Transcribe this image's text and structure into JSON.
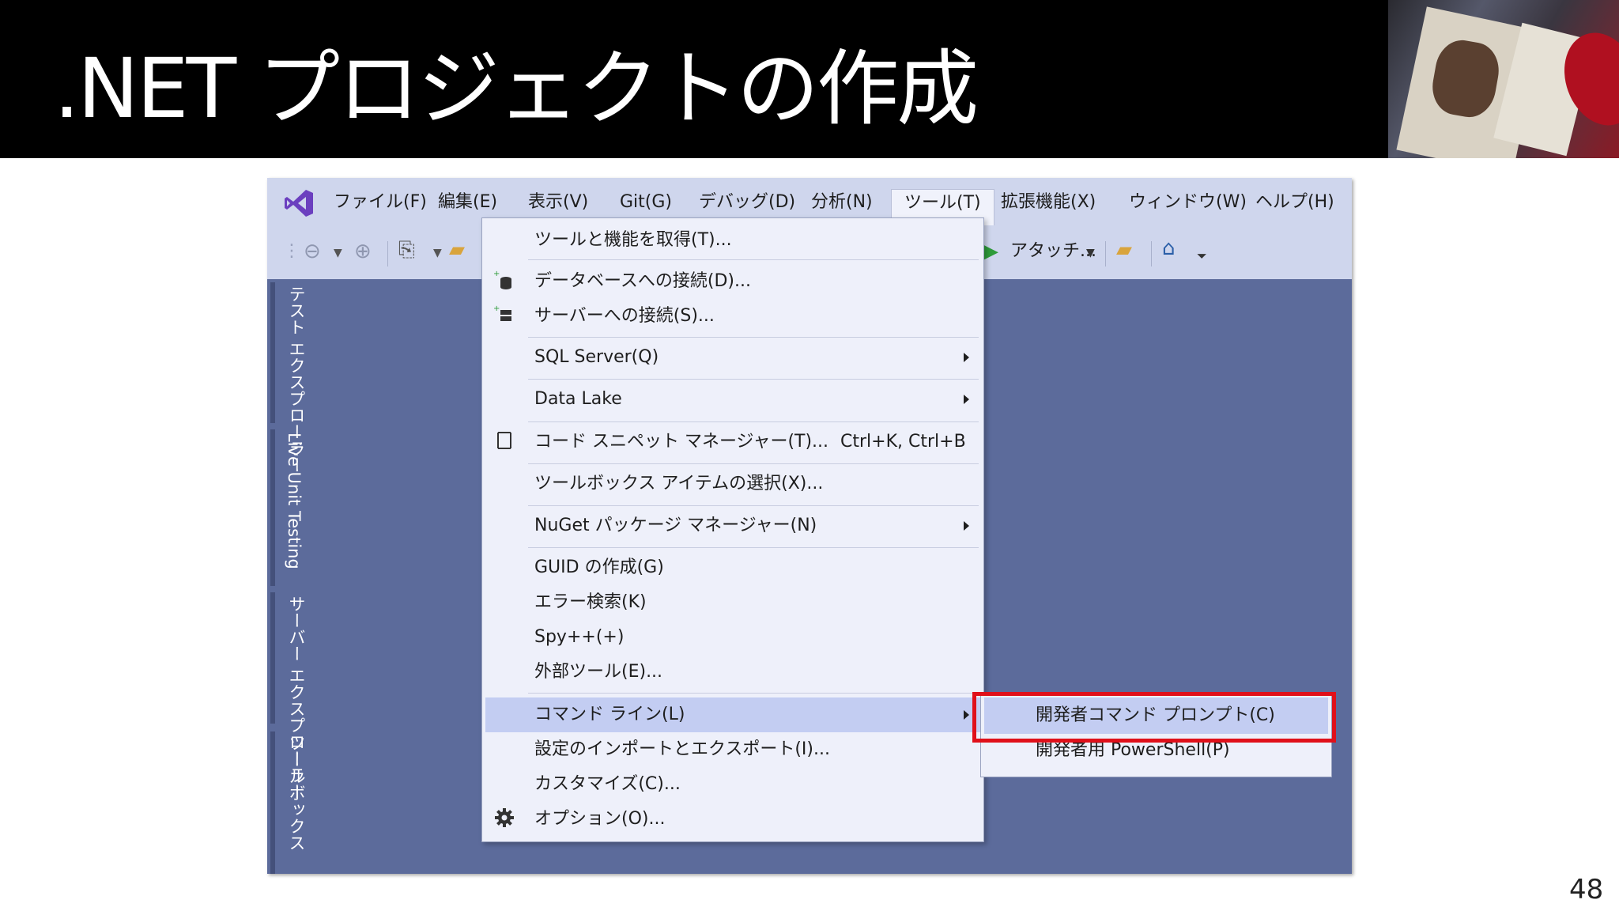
{
  "slide": {
    "title": ".NET プロジェクトの作成",
    "page_number": "48"
  },
  "menubar": {
    "items": [
      "ファイル(F)",
      "編集(E)",
      "表示(V)",
      "Git(G)",
      "デバッグ(D)",
      "分析(N)",
      "ツール(T)",
      "拡張機能(X)",
      "ウィンドウ(W)",
      "ヘルプ(H)"
    ],
    "active": "ツール(T)"
  },
  "toolbar": {
    "attach_label": "アタッチ..."
  },
  "left_rail": {
    "tabs": [
      "テスト エクスプローラー",
      "Live Unit Testing",
      "サーバー エクスプローラー",
      "ツールボックス"
    ]
  },
  "tools_menu": {
    "items": [
      {
        "label": "ツールと機能を取得(T)..."
      },
      {
        "label": "データベースへの接続(D)...",
        "icon": "database-connect-icon"
      },
      {
        "label": "サーバーへの接続(S)...",
        "icon": "server-connect-icon"
      },
      {
        "label": "SQL Server(Q)",
        "submenu": true
      },
      {
        "label": "Data Lake",
        "submenu": true
      },
      {
        "label": "コード スニペット マネージャー(T)...",
        "shortcut": "Ctrl+K, Ctrl+B",
        "icon": "snippet-icon"
      },
      {
        "label": "ツールボックス アイテムの選択(X)..."
      },
      {
        "label": "NuGet パッケージ マネージャー(N)",
        "submenu": true
      },
      {
        "label": "GUID の作成(G)"
      },
      {
        "label": "エラー検索(K)"
      },
      {
        "label": "Spy++(+)"
      },
      {
        "label": "外部ツール(E)..."
      },
      {
        "label": "コマンド ライン(L)",
        "submenu": true,
        "highlighted": true
      },
      {
        "label": "設定のインポートとエクスポート(I)..."
      },
      {
        "label": "カスタマイズ(C)..."
      },
      {
        "label": "オプション(O)...",
        "icon": "gear-icon"
      }
    ]
  },
  "command_line_submenu": {
    "items": [
      "開発者コマンド プロンプト(C)",
      "開発者用 PowerShell(P)"
    ],
    "highlighted": "開発者コマンド プロンプト(C)"
  },
  "colors": {
    "accent_highlight": "#e0101a",
    "menu_hover": "#c3cdf2",
    "ide_background": "#5c6b9b"
  }
}
